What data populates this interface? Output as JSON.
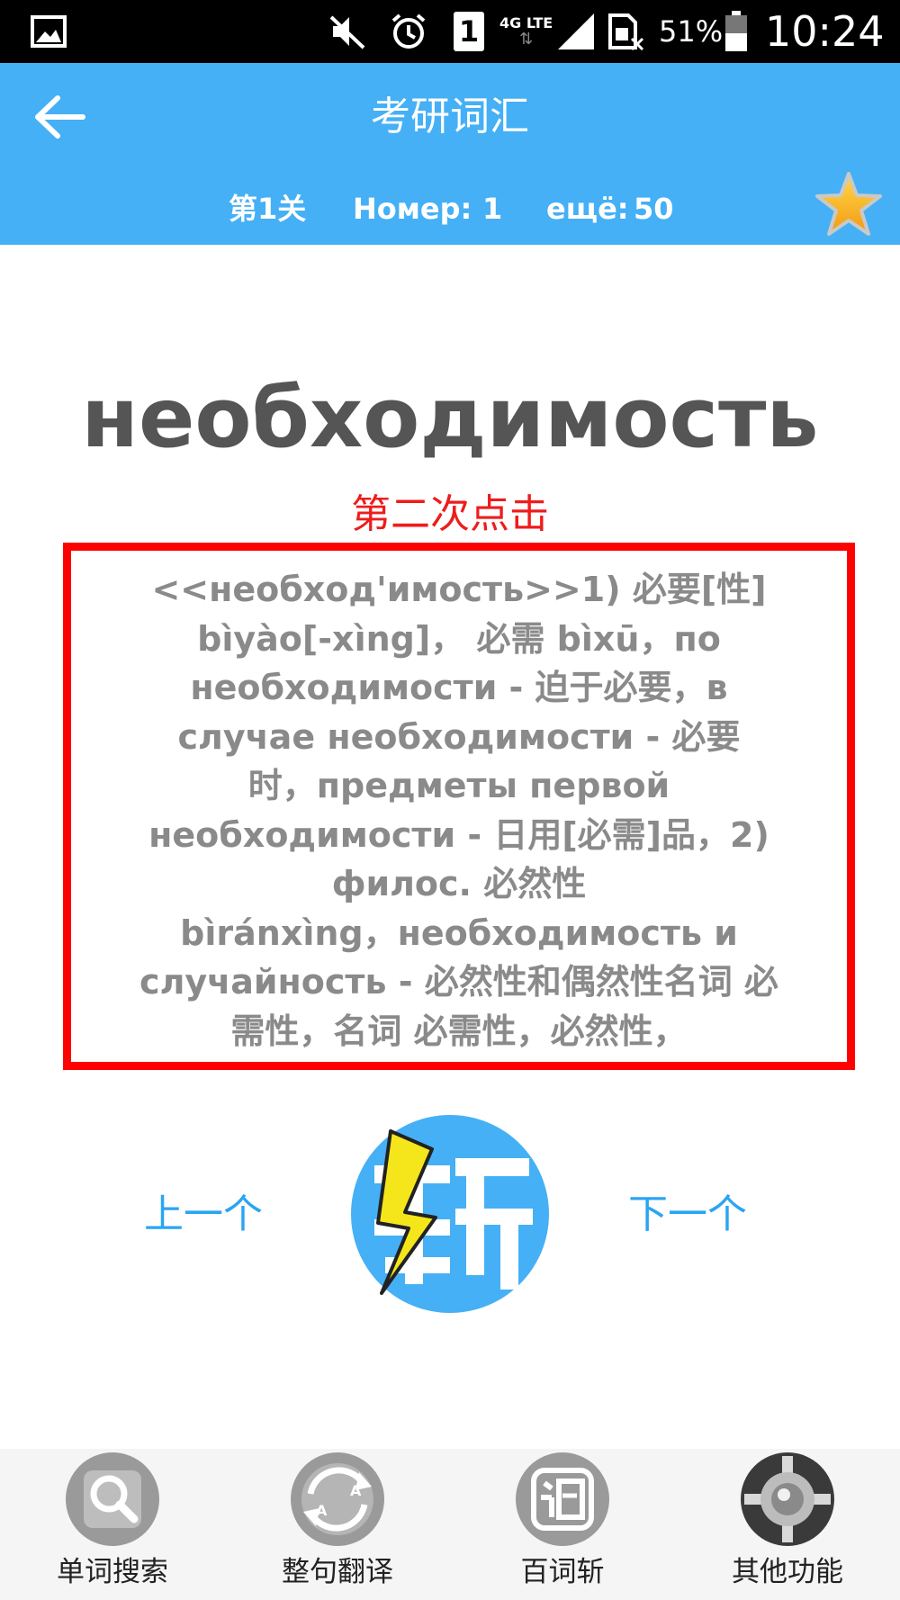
{
  "status_bar": {
    "network": "4G LTE",
    "battery": "51%",
    "time": "10:24",
    "sim": "1"
  },
  "header": {
    "title": "考研词汇",
    "level": "第1关",
    "number_label": "Номер:",
    "number_value": "1",
    "remaining_label": "ещё:",
    "remaining_value": "50"
  },
  "word": "необходимость",
  "hint": "第二次点击",
  "definition_lines": [
    "<<необход'имость>>1) 必要[性]",
    "bìyào[-xìng]， 必需 bìxū，по",
    "необходимости - 迫于必要，в",
    "случае необходимости - 必要",
    "时，предметы первой",
    "необходимости - 日用[必需]品，2)",
    "филос. 必然性",
    "bìránxìng，необходимость и",
    "случайность - 必然性和偶然性名词 必",
    "需性，名词 必需性，必然性，"
  ],
  "nav": {
    "prev": "上一个",
    "next": "下一个"
  },
  "tabs": [
    {
      "label": "单词搜索",
      "icon": "search-icon"
    },
    {
      "label": "整句翻译",
      "icon": "translate-icon"
    },
    {
      "label": "百词斩",
      "icon": "word-icon"
    },
    {
      "label": "其他功能",
      "icon": "gear-icon"
    }
  ],
  "colors": {
    "header_bg": "#45b0f5",
    "link": "#2aa5f2",
    "hint": "#ee1c1c",
    "box_border": "#ff0000",
    "star": "#f6a417"
  }
}
